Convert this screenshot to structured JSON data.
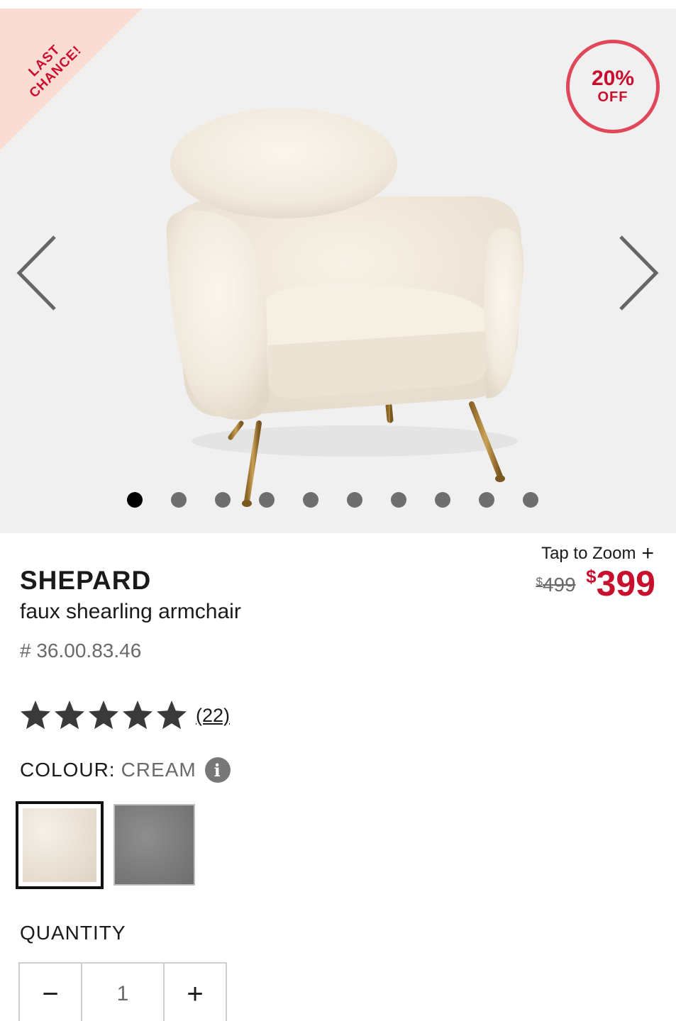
{
  "gallery": {
    "ribbon_line1": "LAST",
    "ribbon_line2": "CHANCE!",
    "discount_pct": "20%",
    "discount_off": "OFF",
    "slide_count": 10,
    "active_slide": 0,
    "prev_icon": "chevron-left-icon",
    "next_icon": "chevron-right-icon"
  },
  "product": {
    "brand": "SHEPARD",
    "subtitle": "faux shearling armchair",
    "sku": "# 36.00.83.46",
    "zoom_label": "Tap to Zoom",
    "zoom_icon": "plus-icon",
    "currency": "$",
    "old_price": "499",
    "new_price": "399",
    "rating_stars": 5,
    "review_count": "(22)",
    "accent_color": "#c8102e"
  },
  "colour": {
    "label": "COLOUR:",
    "value": "CREAM",
    "info_icon": "info-icon",
    "info_glyph": "i",
    "swatches": [
      {
        "name": "cream",
        "selected": true
      },
      {
        "name": "grey",
        "selected": false
      }
    ]
  },
  "quantity": {
    "label": "QUANTITY",
    "minus": "−",
    "value": "1",
    "plus": "+"
  }
}
